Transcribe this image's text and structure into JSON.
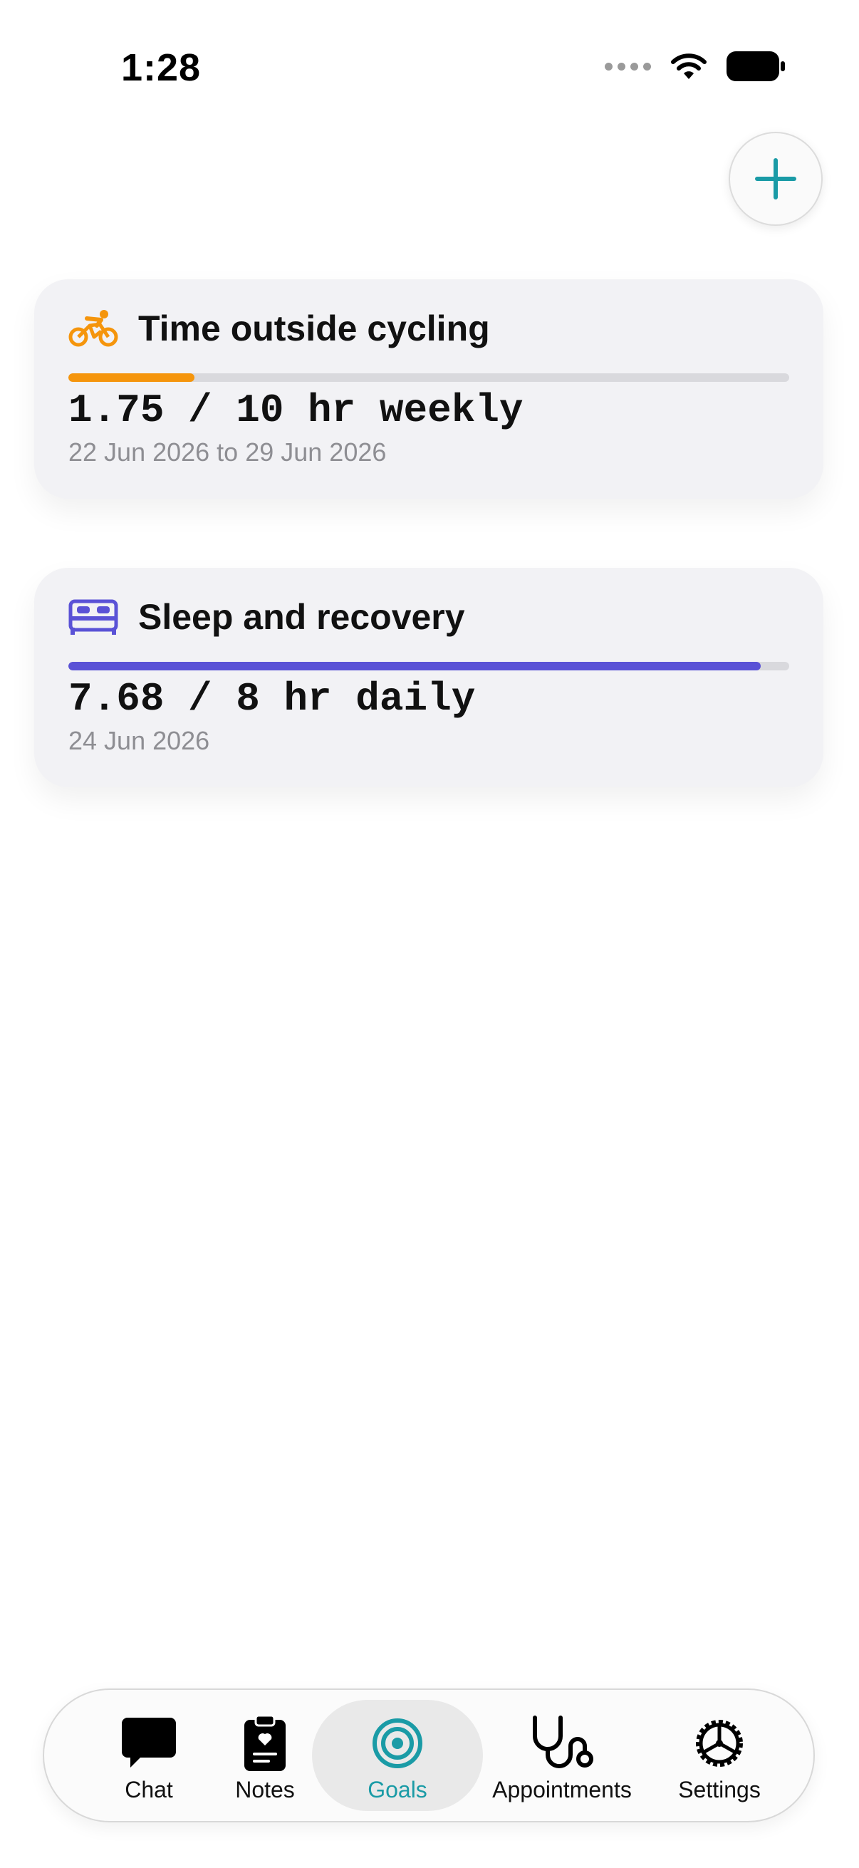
{
  "status_bar": {
    "time": "1:28"
  },
  "colors": {
    "accent": "#1a9ba6",
    "cycling": "#f5950c",
    "sleep": "#5a52d6"
  },
  "add_button": {
    "icon": "plus-icon"
  },
  "goals": [
    {
      "icon": "bicycle-icon",
      "title": "Time outside cycling",
      "value": "1.75 / 10 hr weekly",
      "dates": "22 Jun 2026 to 29 Jun 2026",
      "progress": 0.175
    },
    {
      "icon": "bed-icon",
      "title": "Sleep and recovery",
      "value": "7.68 / 8 hr daily",
      "dates": "24 Jun 2026",
      "progress": 0.96
    }
  ],
  "tab_bar": {
    "tabs": [
      {
        "label": "Chat",
        "icon": "chat-bubble-icon",
        "active": false
      },
      {
        "label": "Notes",
        "icon": "clipboard-icon",
        "active": false
      },
      {
        "label": "Goals",
        "icon": "target-icon",
        "active": true
      },
      {
        "label": "Appointments",
        "icon": "stethoscope-icon",
        "active": false
      },
      {
        "label": "Settings",
        "icon": "gear-icon",
        "active": false
      }
    ]
  }
}
